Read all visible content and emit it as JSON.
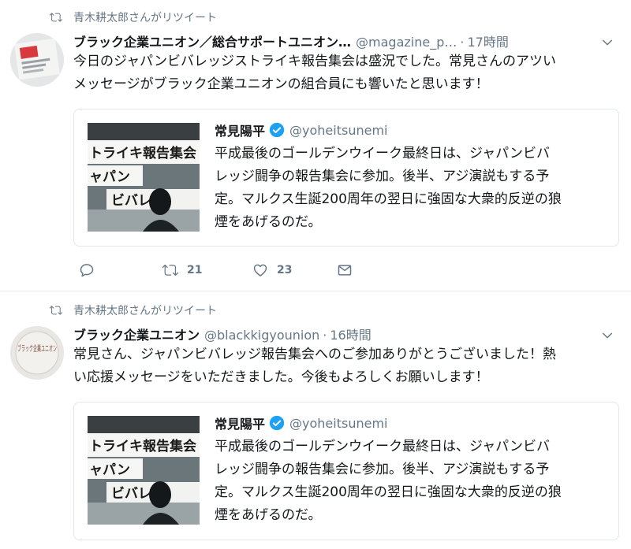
{
  "timeline": {
    "tweets": [
      {
        "retweeted_by": "青木耕太郎さんがリツイート",
        "name": "ブラック企業ユニオン／総合サポートユニオン…",
        "handle": "@magazine_p…",
        "dot": "·",
        "time": "17時間",
        "text_line1": "今日のジャパンビバレッジストライキ報告集会は盛況でした。常見さんのアツい",
        "text_line2": "メッセージがブラック企業ユニオンの組合員にも響いたと思います！",
        "quote": {
          "name": "常見陽平",
          "handle": "@yoheitsunemi",
          "line1": "平成最後のゴールデンウイーク最終日は、ジャパンビバ",
          "line2": "レッジ闘争の報告集会に参加。後半、アジ演説もする予",
          "line3": "定。マルクス生誕200周年の翌日に強固な大衆的反逆の狼",
          "line4": "煙をあげるのだ。",
          "image_text1": "トライキ報告集会",
          "image_text2": "ャパン",
          "image_text3": "ビバレジ"
        },
        "retweet_count": "21",
        "like_count": "23",
        "avatar_text": ""
      },
      {
        "retweeted_by": "青木耕太郎さんがリツイート",
        "name": "ブラック企業ユニオン",
        "handle": "@blackkigyounion",
        "dot": "·",
        "time": "16時間",
        "text_line1": "常見さん、ジャパンビバレッジ報告集会へのご参加ありがとうございました！熱",
        "text_line2": "い応援メッセージをいただきました。今後もよろしくお願いします！",
        "quote": {
          "name": "常見陽平",
          "handle": "@yoheitsunemi",
          "line1": "平成最後のゴールデンウイーク最終日は、ジャパンビバ",
          "line2": "レッジ闘争の報告集会に参加。後半、アジ演説もする予",
          "line3": "定。マルクス生誕200周年の翌日に強固な大衆的反逆の狼",
          "line4": "煙をあげるのだ。",
          "image_text1": "トライキ報告集会",
          "image_text2": "ャパン",
          "image_text3": "ビバレジ"
        },
        "avatar_text": "ブラック企業ユニオン"
      }
    ]
  },
  "icons": {
    "retweet": "retweet-icon",
    "reply": "reply-icon",
    "like": "heart-icon",
    "message": "envelope-icon",
    "caret": "chevron-down-icon",
    "verified": "verified-badge-icon"
  },
  "colors": {
    "secondary_text": "#657786",
    "verified": "#1da1f2",
    "divider": "#e6ecf0"
  }
}
